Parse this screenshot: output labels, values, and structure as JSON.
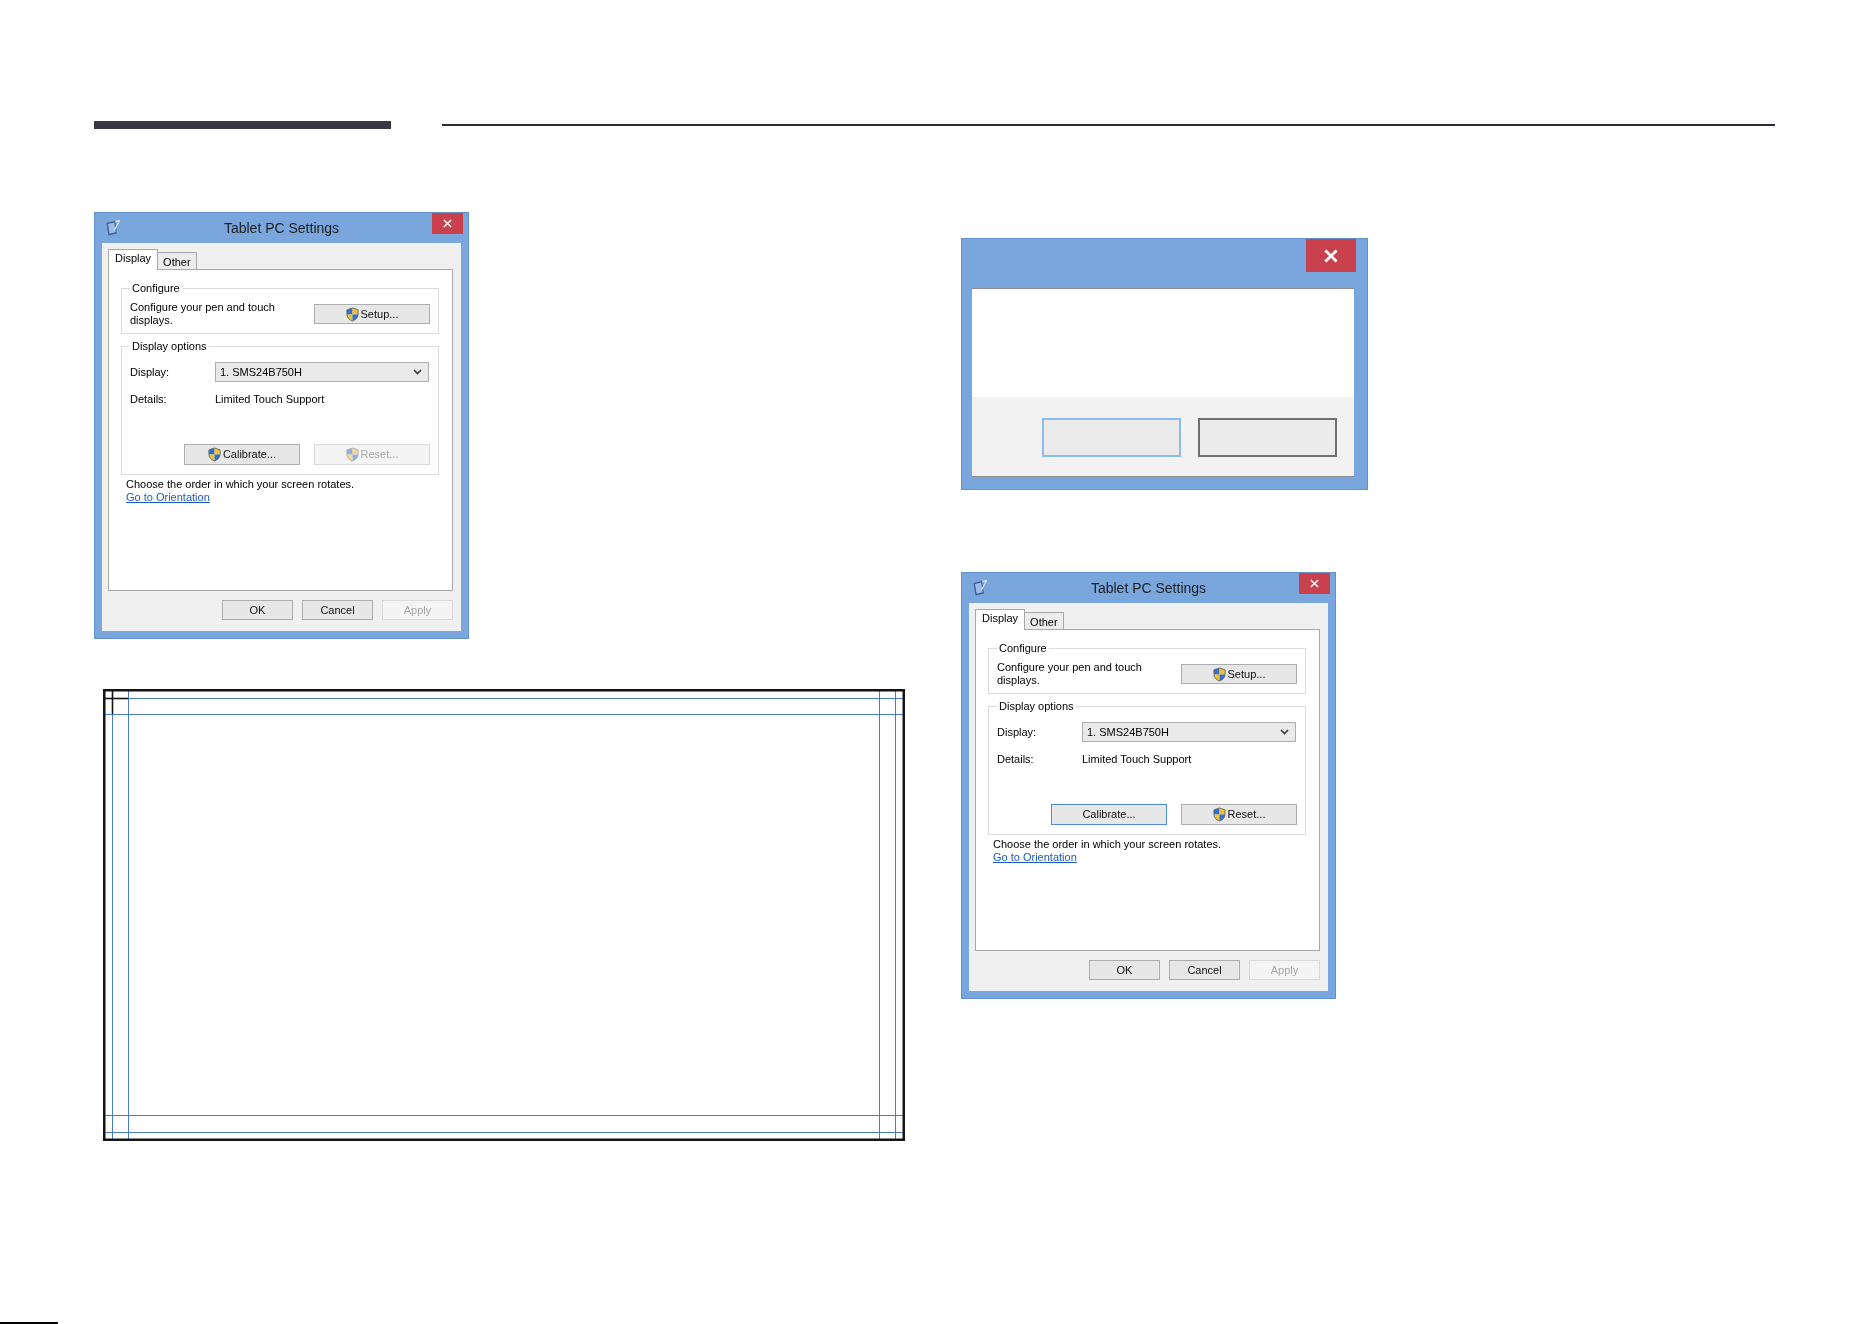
{
  "left_column": [
    {
      "kind": "settings_dialog",
      "title": "Tablet PC Settings",
      "tabs": [
        {
          "label": "Display",
          "selected": true
        },
        {
          "label": "Other",
          "selected": false
        }
      ],
      "configure": {
        "heading": "Configure",
        "text": "Configure your pen and touch displays.",
        "button": {
          "label": "Setup...",
          "shield": true,
          "disabled": false
        }
      },
      "display_options": {
        "heading": "Display options",
        "fields": [
          {
            "kind": "dropdown",
            "label": "Display:",
            "value": "1. SMS24B750H"
          },
          {
            "kind": "text",
            "label": "Details:",
            "value": "Limited Touch Support"
          }
        ],
        "buttons": [
          {
            "label": "Calibrate...",
            "shield": true,
            "disabled": false,
            "focused": false
          },
          {
            "label": "Reset...",
            "shield": true,
            "disabled": true,
            "focused": false
          }
        ]
      },
      "orientation": {
        "text": "Choose the order in which your screen rotates.",
        "link": "Go to Orientation"
      },
      "footer_buttons": [
        {
          "label": "OK",
          "disabled": false
        },
        {
          "label": "Cancel",
          "disabled": false
        },
        {
          "label": "Apply",
          "disabled": true
        }
      ]
    },
    {
      "kind": "calibration_screen"
    }
  ],
  "right_column": [
    {
      "kind": "message_box",
      "buttons": [
        {
          "focused": true
        },
        {
          "focused": false
        }
      ]
    },
    {
      "kind": "settings_dialog",
      "title": "Tablet PC Settings",
      "tabs": [
        {
          "label": "Display",
          "selected": true
        },
        {
          "label": "Other",
          "selected": false
        }
      ],
      "configure": {
        "heading": "Configure",
        "text": "Configure your pen and touch displays.",
        "button": {
          "label": "Setup...",
          "shield": true,
          "disabled": false
        }
      },
      "display_options": {
        "heading": "Display options",
        "fields": [
          {
            "kind": "dropdown",
            "label": "Display:",
            "value": "1. SMS24B750H"
          },
          {
            "kind": "text",
            "label": "Details:",
            "value": "Limited Touch Support"
          }
        ],
        "buttons": [
          {
            "label": "Calibrate...",
            "shield": false,
            "disabled": false,
            "focused": true
          },
          {
            "label": "Reset...",
            "shield": true,
            "disabled": false,
            "focused": false
          }
        ]
      },
      "orientation": {
        "text": "Choose the order in which your screen rotates.",
        "link": "Go to Orientation"
      },
      "footer_buttons": [
        {
          "label": "OK",
          "disabled": false
        },
        {
          "label": "Cancel",
          "disabled": false
        },
        {
          "label": "Apply",
          "disabled": true
        }
      ]
    }
  ]
}
